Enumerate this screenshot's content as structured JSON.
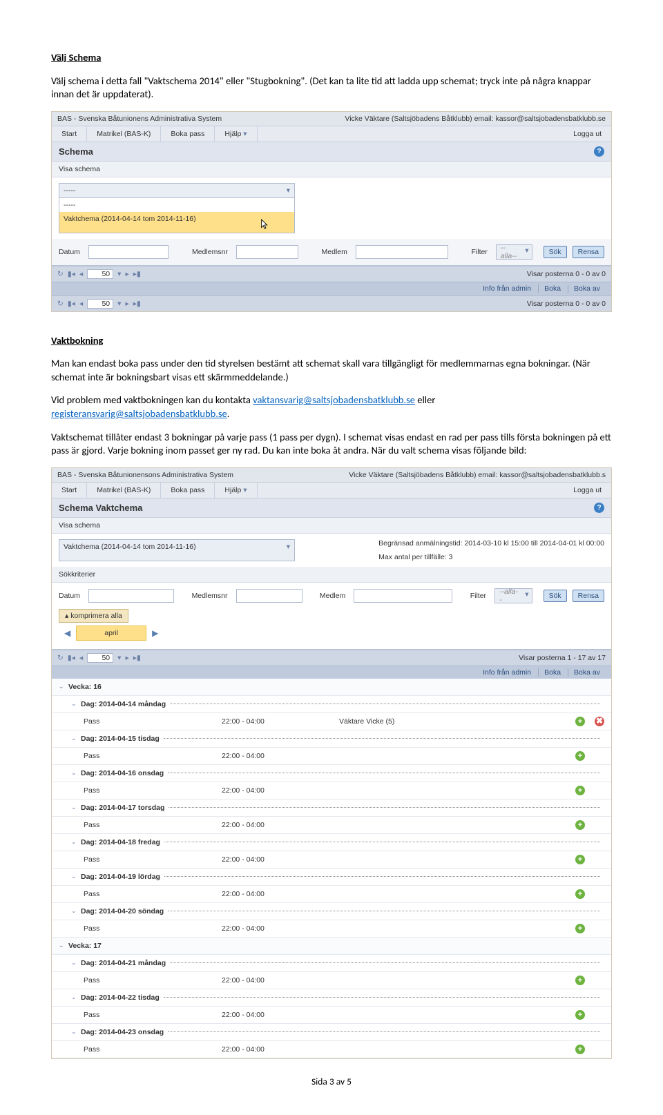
{
  "doc": {
    "h1": "Välj Schema",
    "p1": "Välj schema i detta fall \"Vaktschema 2014\" eller \"Stugbokning\". (Det kan ta lite tid att ladda upp schemat; tryck inte på några knappar innan det är uppdaterat).",
    "h2": "Vaktbokning",
    "p2": "Man kan endast boka pass under den tid styrelsen bestämt att schemat skall vara tillgängligt för medlemmarnas egna bokningar. (När schemat inte är bokningsbart visas ett skärmmeddelande.)",
    "p3a": "Vid problem med vaktbokningen kan du kontakta ",
    "link1": "vaktansvarig@saltsjobadensbatklubb.se",
    "p3b": " eller ",
    "link2": "registeransvarig@saltsjobadensbatklubb.se",
    "p3c": ".",
    "p4": "Vaktschemat tillåter endast 3 bokningar på varje pass (1 pass per dygn). I schemat visas endast en rad per pass tills första bokningen på ett pass är gjord. Varje bokning inom passet ger ny rad. Du kan inte boka åt andra. När du valt schema visas följande bild:",
    "footer": "Sida 3 av 5"
  },
  "s1": {
    "sysname": "BAS - Svenska Båtunionens Administrativa System",
    "sysuser": "Vicke Väktare (Saltsjöbadens Båtklubb) email: kassor@saltsjobadensbatklubb.se",
    "menu1": "Start",
    "menu2": "Matrikel (BAS-K)",
    "menu3": "Boka pass",
    "menu4": "Hjälp",
    "logout": "Logga ut",
    "panel": "Schema",
    "visa": "Visa schema",
    "dd_sel": "-----",
    "dd_opt1": "-----",
    "dd_opt2": "Vaktchema (2014-04-14 tom 2014-11-16)",
    "datum": "Datum",
    "medlemsnr": "Medlemsnr",
    "medlem": "Medlem",
    "filter": "Filter",
    "alla": "--alla--",
    "sok": "Sök",
    "rensa": "Rensa",
    "pagesize": "50",
    "showing": "Visar posterna 0 - 0 av 0",
    "info": "Info från admin",
    "boka": "Boka",
    "bokaav": "Boka av"
  },
  "s2": {
    "sysname": "BAS - Svenska Båtunionensons Administrativa System",
    "sysuser": "Vicke Väktare (Saltsjöbadens Båtklubb) email: kassor@saltsjobadensbatklubb.s",
    "menu1": "Start",
    "menu2": "Matrikel (BAS-K)",
    "menu3": "Boka pass",
    "menu4": "Hjälp",
    "logout": "Logga ut",
    "panel": "Schema Vaktchema",
    "visa": "Visa schema",
    "begransad": "Begränsad anmälningstid: 2014-03-10 kl 15:00 till 2014-04-01 kl 00:00",
    "maxantal": "Max antal per tillfälle: 3",
    "dd_sel": "Vaktchema (2014-04-14 tom 2014-11-16)",
    "sokk": "Sökkriterier",
    "datum": "Datum",
    "medlemsnr": "Medlemsnr",
    "medlem": "Medlem",
    "filter": "Filter",
    "alla": "--alla--",
    "sok": "Sök",
    "rensa": "Rensa",
    "komp": "komprimera alla",
    "month": "april",
    "pagesize": "50",
    "showing": "Visar posterna 1 - 17 av 17",
    "info": "Info från admin",
    "boka": "Boka",
    "bokaav": "Boka av",
    "vecka16": "Vecka: 16",
    "vecka17": "Vecka: 17",
    "days": {
      "d1": "Dag: 2014-04-14 måndag",
      "d2": "Dag: 2014-04-15 tisdag",
      "d3": "Dag: 2014-04-16 onsdag",
      "d4": "Dag: 2014-04-17 torsdag",
      "d5": "Dag: 2014-04-18 fredag",
      "d6": "Dag: 2014-04-19 lördag",
      "d7": "Dag: 2014-04-20 söndag",
      "d8": "Dag: 2014-04-21 måndag",
      "d9": "Dag: 2014-04-22 tisdag",
      "d10": "Dag: 2014-04-23 onsdag"
    },
    "pass": "Pass",
    "time": "22:00 - 04:00",
    "vaktare": "Väktare Vicke (5)"
  }
}
